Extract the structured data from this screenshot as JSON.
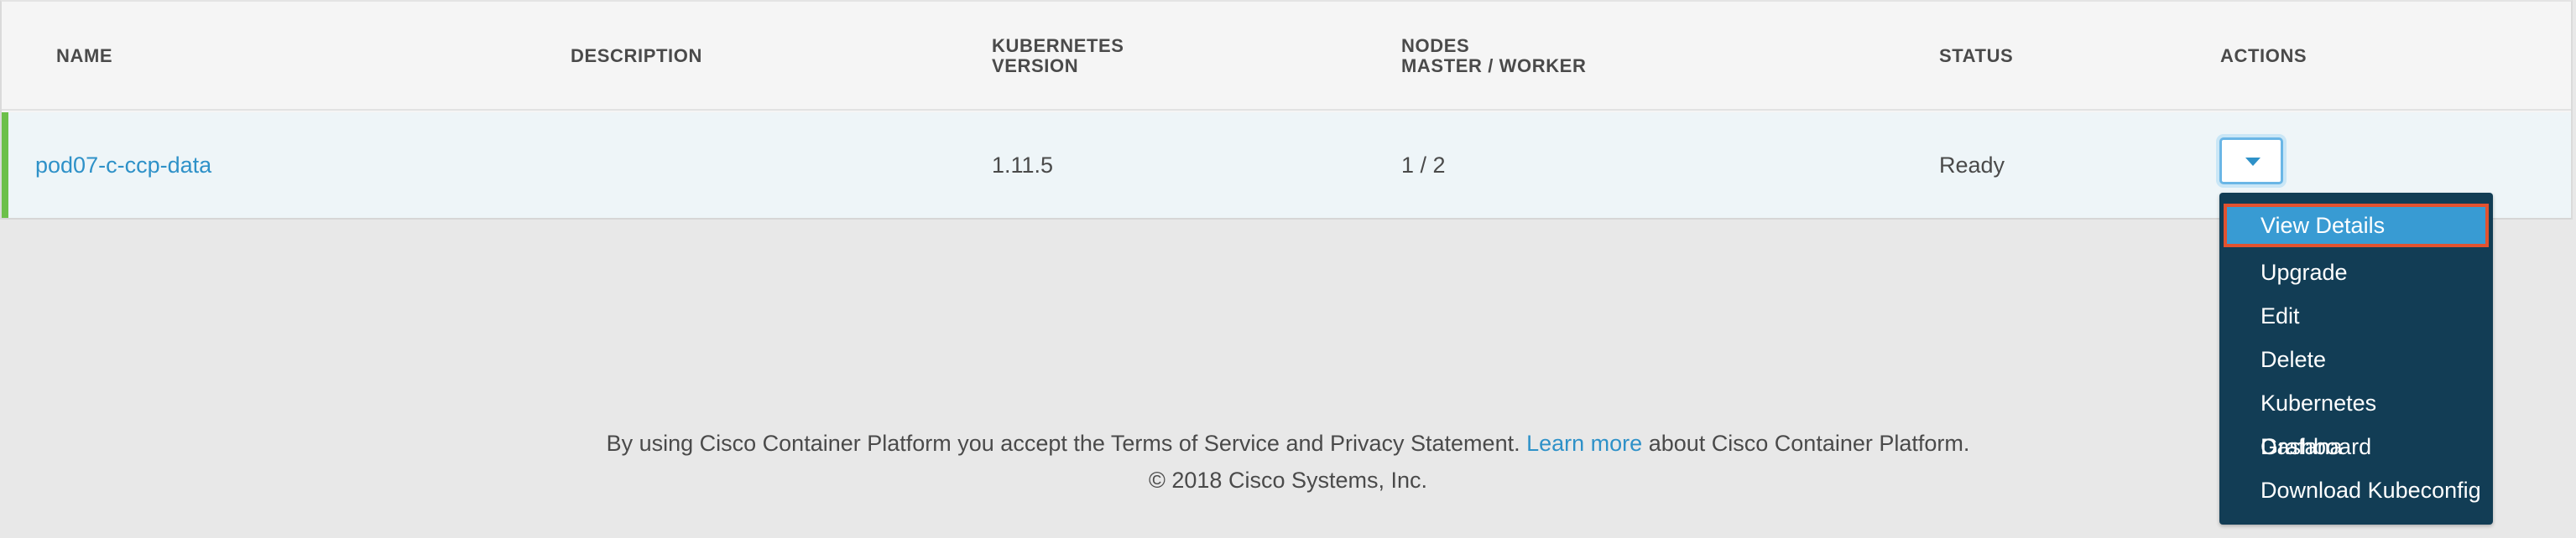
{
  "table": {
    "headers": {
      "name": "NAME",
      "description": "DESCRIPTION",
      "k8s_version_line1": "KUBERNETES",
      "k8s_version_line2": "VERSION",
      "nodes_line1": "NODES",
      "nodes_line2": "MASTER / WORKER",
      "status": "STATUS",
      "actions": "ACTIONS"
    },
    "rows": [
      {
        "name": "pod07-c-ccp-data",
        "description": "",
        "k8s_version": "1.11.5",
        "nodes": "1 / 2",
        "status": "Ready"
      }
    ]
  },
  "actions_menu": {
    "items": [
      "View Details",
      "Upgrade",
      "Edit",
      "Delete",
      "Kubernetes Dashboard",
      "Grafana",
      "Download Kubeconfig"
    ],
    "selected_index": 0
  },
  "footer": {
    "text_before": "By using Cisco Container Platform you accept the Terms of Service and Privacy Statement.",
    "link": "Learn more",
    "text_after": "about Cisco Container Platform.",
    "copyright": "© 2018 Cisco Systems, Inc."
  },
  "colors": {
    "accent": "#2e91c8",
    "row_indicator": "#6cc04a",
    "menu_bg": "#123d55",
    "menu_selected": "#389bd3",
    "highlight_border": "#e2522f"
  }
}
